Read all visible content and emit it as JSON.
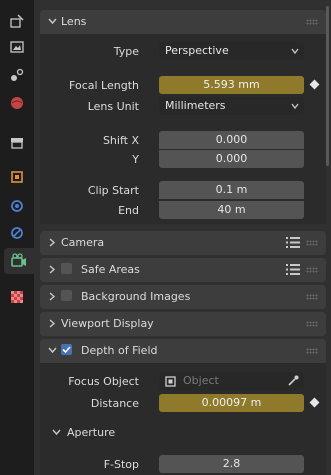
{
  "tabs": [
    "tool-icon",
    "render-icon",
    "output-icon",
    "view-layer-icon",
    "scene-icon",
    "world-icon",
    "collection-icon",
    "object-icon",
    "modifiers-icon",
    "physics-icon",
    "camera-data-icon",
    "texture-icon"
  ],
  "lens": {
    "title": "Lens",
    "type_label": "Type",
    "type_value": "Perspective",
    "focal_label": "Focal Length",
    "focal_value": "5.593 mm",
    "unit_label": "Lens Unit",
    "unit_value": "Millimeters",
    "shiftx_label": "Shift X",
    "shiftx_value": "0.000",
    "shifty_label": "Y",
    "shifty_value": "0.000",
    "clipstart_label": "Clip Start",
    "clipstart_value": "0.1 m",
    "clipend_label": "End",
    "clipend_value": "40 m"
  },
  "panels": {
    "camera": "Camera",
    "safe_areas": "Safe Areas",
    "background_images": "Background Images",
    "viewport_display": "Viewport Display",
    "dof": "Depth of Field"
  },
  "dof": {
    "focus_label": "Focus Object",
    "focus_placeholder": "Object",
    "distance_label": "Distance",
    "distance_value": "0.00097 m",
    "aperture_title": "Aperture",
    "fstop_label": "F-Stop",
    "fstop_value": "2.8"
  },
  "colors": {
    "accent": "#4772b3",
    "animated": "#8e7a2a",
    "camera_active": "#6ac08a"
  }
}
